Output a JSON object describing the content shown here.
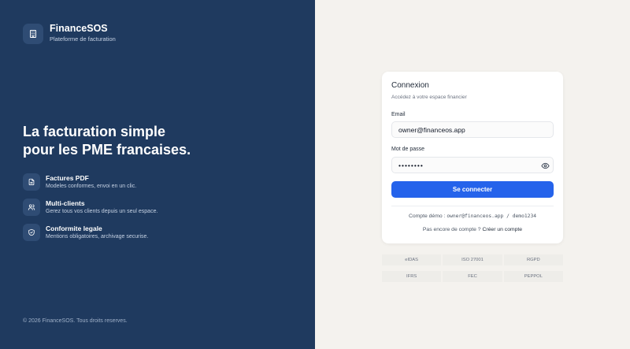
{
  "brand": {
    "name": "FinanceSOS",
    "subtitle": "Plateforme de facturation",
    "logo_icon": "building-icon"
  },
  "hero": {
    "line1": "La facturation simple",
    "line2": "pour les PME francaises."
  },
  "features": [
    {
      "icon": "file-icon",
      "title": "Factures PDF",
      "desc": "Modeles conformes, envoi en un clic."
    },
    {
      "icon": "users-icon",
      "title": "Multi-clients",
      "desc": "Gerez tous vos clients depuis un seul espace."
    },
    {
      "icon": "shield-check-icon",
      "title": "Conformite legale",
      "desc": "Mentions obligatoires, archivage securise."
    }
  ],
  "footer": "© 2026 FinanceSOS. Tous droits reserves.",
  "login": {
    "title": "Connexion",
    "subtitle": "Accédez à votre espace financier",
    "email_label": "Email",
    "email_value": "owner@financeos.app",
    "password_label": "Mot de passe",
    "password_value": "demo1234",
    "submit_label": "Se connecter",
    "demo_prefix": "Compte démo : ",
    "demo_credentials": "owner@financeos.app / demo1234",
    "signup_prefix": "Pas encore de compte ? ",
    "signup_link": "Créer un compte"
  },
  "badges": [
    "eIDAS",
    "ISO 27001",
    "RGPD",
    "IFRS",
    "FEC",
    "PEPPOL"
  ],
  "colors": {
    "left_panel": "#1f3a5f",
    "accent": "#2563eb",
    "right_panel": "#f4f2ee"
  }
}
